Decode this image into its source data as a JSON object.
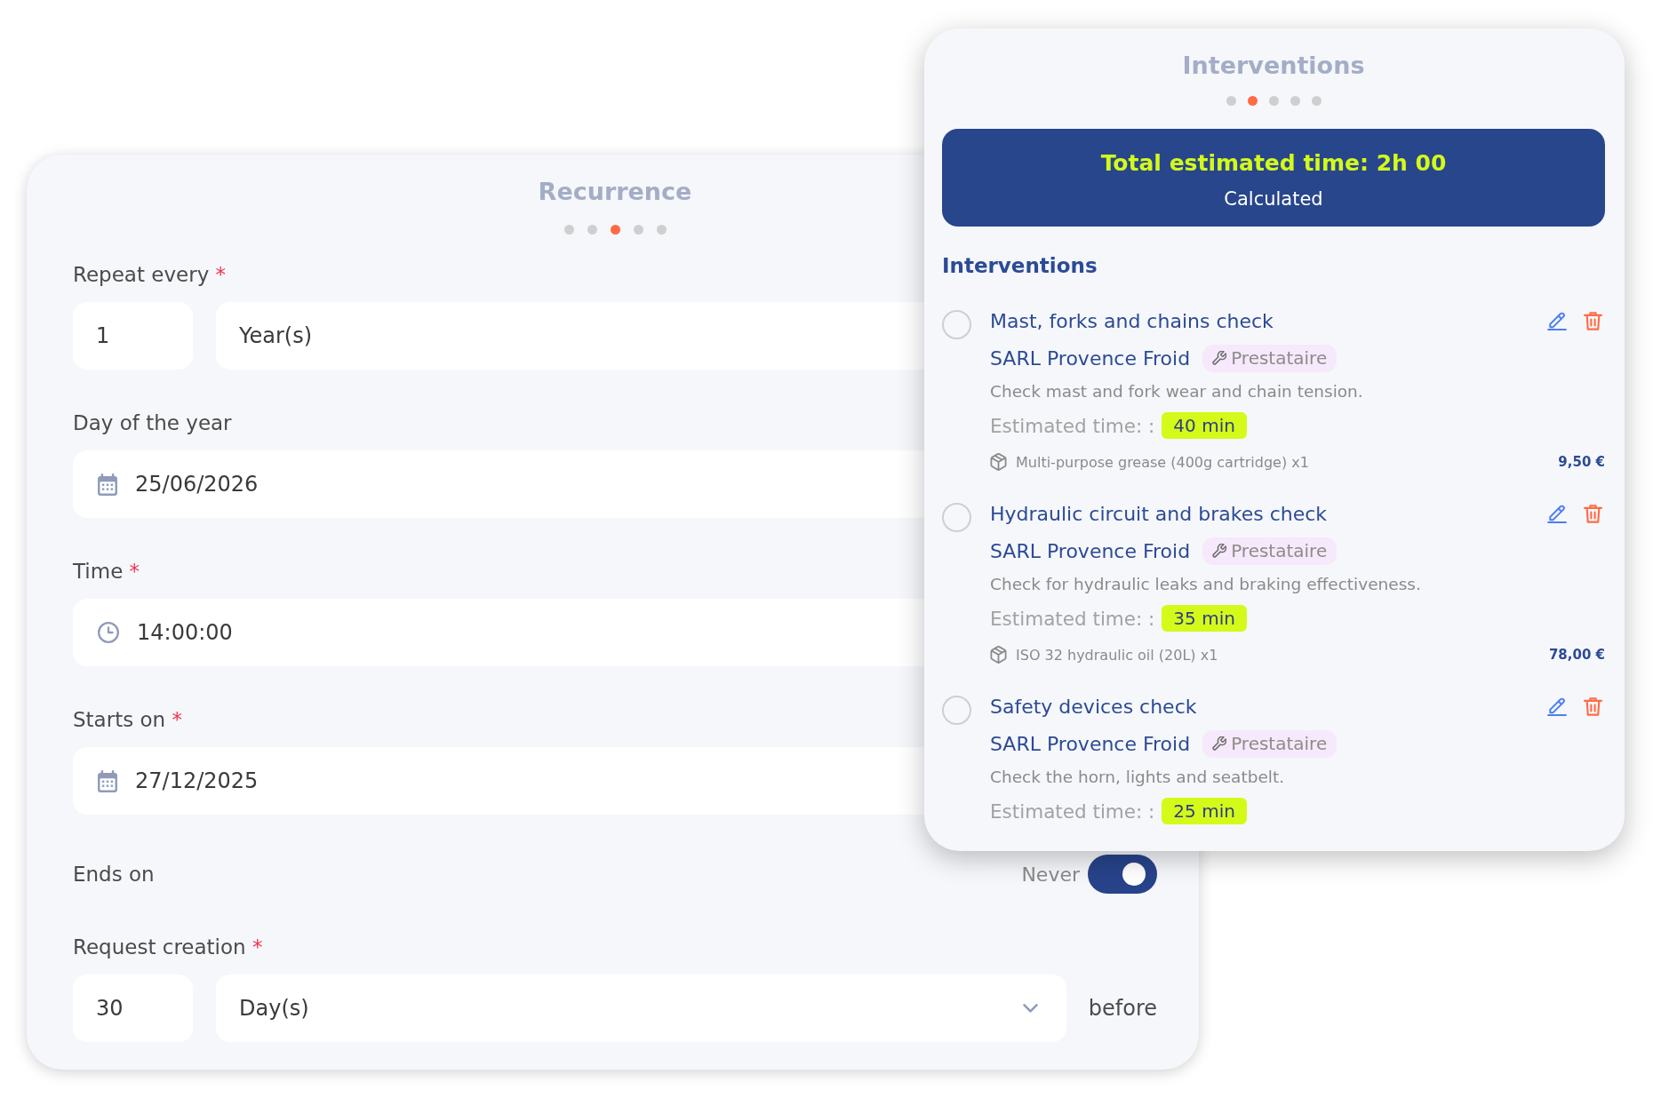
{
  "recurrence": {
    "title": "Recurrence",
    "steps": [
      {
        "selected": false
      },
      {
        "selected": false
      },
      {
        "selected": true
      },
      {
        "selected": false
      },
      {
        "selected": false
      }
    ],
    "fields": [
      {
        "kind": "number_unit",
        "label": "Repeat every",
        "required_mark": "*",
        "value": "1",
        "unit": "Year(s)"
      },
      {
        "kind": "date",
        "label": "Day of the year",
        "value": "25/06/2026"
      },
      {
        "kind": "time",
        "label": "Time",
        "required_mark": "*",
        "value": "14:00:00"
      },
      {
        "kind": "date",
        "label": "Starts on",
        "required_mark": "*",
        "value": "27/12/2025"
      },
      {
        "kind": "toggle",
        "label": "Ends on",
        "option": "Never",
        "on": true
      },
      {
        "kind": "number_select",
        "label": "Request creation",
        "required_mark": "*",
        "value": "30",
        "unit": "Day(s)",
        "suffix": "before"
      }
    ]
  },
  "interventions_panel": {
    "title": "Interventions",
    "steps": [
      {
        "selected": false
      },
      {
        "selected": true
      },
      {
        "selected": false
      },
      {
        "selected": false
      },
      {
        "selected": false
      }
    ],
    "summary": {
      "total": "Total estimated time: 2h 00",
      "note": "Calculated"
    },
    "section_title": "Interventions",
    "items": [
      {
        "selected": false,
        "title": "Mast, forks and chains check",
        "provider": "SARL Provence Froid",
        "provider_tag": "Prestataire",
        "description": "Check mast and fork wear and chain tension.",
        "estimate_label": "Estimated time: :",
        "estimate": "40 min",
        "parts": [
          {
            "name": "Multi-purpose grease (400g cartridge) x1",
            "price": "9,50 €"
          }
        ]
      },
      {
        "selected": false,
        "title": "Hydraulic circuit and brakes check",
        "provider": "SARL Provence Froid",
        "provider_tag": "Prestataire",
        "description": "Check for hydraulic leaks and braking effectiveness.",
        "estimate_label": "Estimated time: :",
        "estimate": "35 min",
        "parts": [
          {
            "name": "ISO 32 hydraulic oil (20L) x1",
            "price": "78,00 €"
          }
        ]
      },
      {
        "selected": false,
        "title": "Safety devices check",
        "provider": "SARL Provence Froid",
        "provider_tag": "Prestataire",
        "description": "Check the horn, lights and seatbelt.",
        "estimate_label": "Estimated time: :",
        "estimate": "25 min"
      }
    ]
  }
}
